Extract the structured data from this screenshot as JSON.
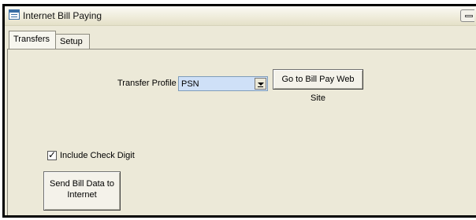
{
  "window": {
    "title": "Internet Bill Paying",
    "icon": "form-icon"
  },
  "tabs": [
    {
      "label": "Transfers",
      "active": true
    },
    {
      "label": "Setup",
      "active": false
    }
  ],
  "transfer_profile": {
    "label": "Transfer Profile",
    "value": "PSN"
  },
  "go_to_site_button": {
    "label": "Go to Bill Pay Web Site"
  },
  "include_check_digit": {
    "label": "Include Check Digit",
    "checked": true,
    "mark": "✓"
  },
  "send_button": {
    "line1": "Send Bill Data to",
    "line2": "Internet"
  }
}
